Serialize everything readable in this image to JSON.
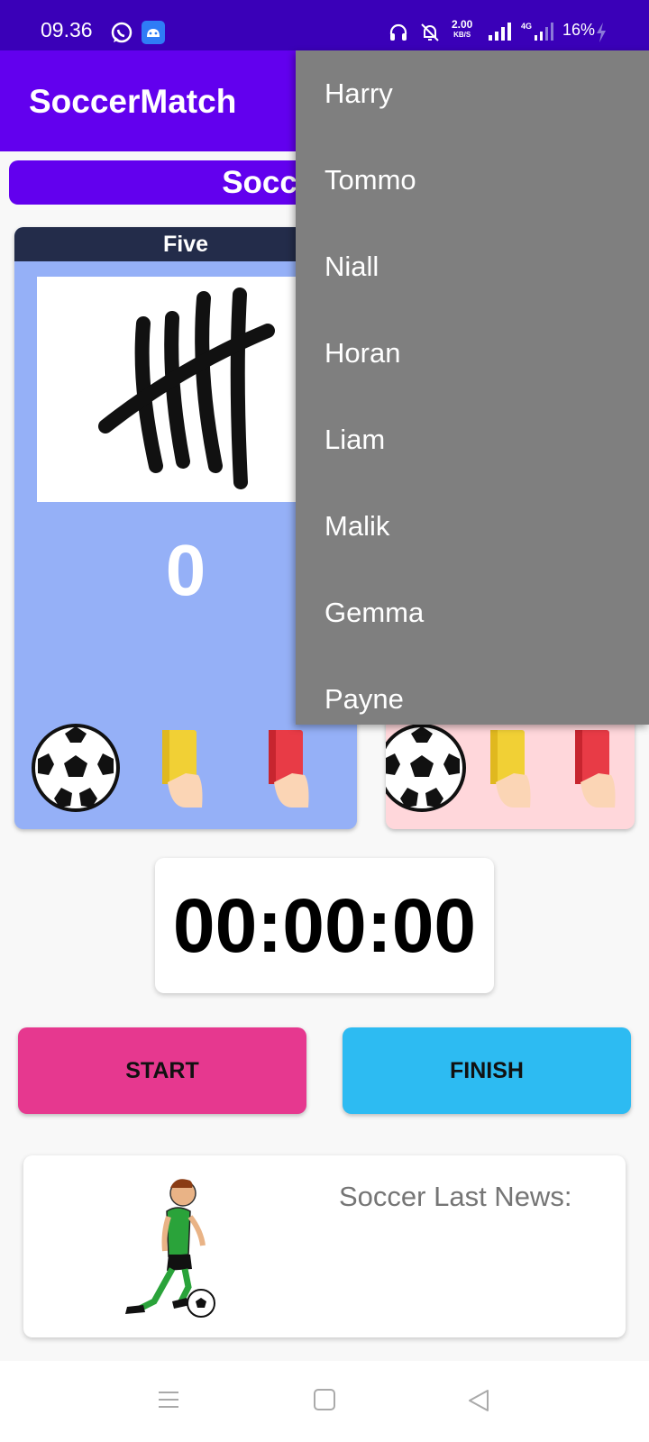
{
  "status_bar": {
    "time": "09.36",
    "speed_value": "2.00",
    "speed_unit": "KB/S",
    "network": "4G",
    "battery": "16%"
  },
  "app": {
    "title": "SoccerMatch"
  },
  "match_title": "Soccer Match",
  "team_left": {
    "name": "Five",
    "score": "0"
  },
  "timer": "00:00:00",
  "buttons": {
    "start": "START",
    "finish": "FINISH"
  },
  "news": {
    "title": "Soccer Last News:"
  },
  "dropdown": {
    "items": [
      "Harry",
      "Tommo",
      "Niall",
      "Horan",
      "Liam",
      "Malik",
      "Gemma",
      "Payne"
    ]
  },
  "colors": {
    "status_bar": "#3a00b8",
    "app_bar": "#6200ee",
    "team_left_bg": "#95b0f7",
    "team_right_bg": "#ffd7db",
    "team_header": "#232c4a",
    "start_button": "#e6388f",
    "finish_button": "#2dbbf2",
    "dropdown_bg": "#7f7f7f"
  },
  "icons": [
    "whatsapp-icon",
    "android-icon",
    "headset-icon",
    "mute-icon",
    "signal-icon",
    "battery-icon",
    "tally-five-image",
    "soccer-ball-icon",
    "yellow-card-icon",
    "red-card-icon",
    "player-icon",
    "menu-icon",
    "home-icon",
    "back-icon"
  ]
}
